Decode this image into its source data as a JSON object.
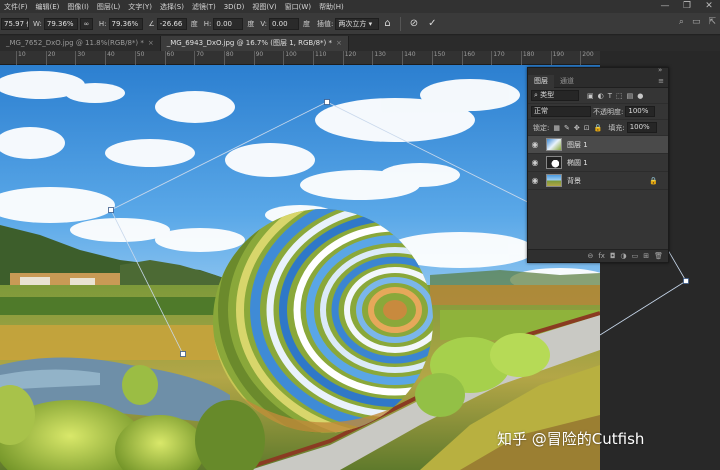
{
  "menu": [
    "文件(F)",
    "编辑(E)",
    "图像(I)",
    "图层(L)",
    "文字(Y)",
    "选择(S)",
    "滤镜(T)",
    "3D(D)",
    "视图(V)",
    "窗口(W)",
    "帮助(H)"
  ],
  "window_controls": [
    "—",
    "❐",
    "✕"
  ],
  "options": {
    "x_value": "75.97 像",
    "w_label": "W:",
    "w_value": "79.36%",
    "link_icon": "∞",
    "h_label": "H:",
    "h_value": "79.36%",
    "angle_icon": "∠",
    "angle_value": "-26.66",
    "angle_unit": "度",
    "hskew_label": "H:",
    "hskew_value": "0.00",
    "hskew_unit": "度",
    "vskew_label": "V:",
    "vskew_value": "0.00",
    "vskew_unit": "度",
    "interp_label": "插值:",
    "interp_value": "两次立方 ▾",
    "cancel_icon": "⊘",
    "commit_icon": "✓"
  },
  "tabs": [
    {
      "label": "_MG_7652_DxO.jpg @ 11.8%(RGB/8*) *",
      "close": "×"
    },
    {
      "label": "_MG_6943_DxO.jpg @ 16.7% (图层 1, RGB/8*) *",
      "close": "×"
    }
  ],
  "ruler_ticks": [
    "10",
    "20",
    "30",
    "40",
    "50",
    "60",
    "70",
    "80",
    "90",
    "100",
    "110",
    "120",
    "130",
    "140",
    "150",
    "160",
    "170",
    "180",
    "190",
    "200"
  ],
  "panel": {
    "tabs": [
      "图层",
      "通道"
    ],
    "search_placeholder": "类型",
    "blend_mode": "正常",
    "opacity_label": "不透明度:",
    "opacity_value": "100%",
    "lock_label": "锁定:",
    "fill_label": "填充:",
    "fill_value": "100%",
    "layers": [
      {
        "name": "图层 1",
        "selected": true
      },
      {
        "name": "椭圆 1",
        "selected": false
      },
      {
        "name": "背景",
        "selected": false
      }
    ],
    "bottom_icons": [
      "⊖",
      "fx",
      "◘",
      "◑",
      "▭",
      "⊞",
      "🗑"
    ]
  },
  "watermark": "知乎 @冒险的Cutfish",
  "colors": {
    "ps_dark": "#282828",
    "panel": "#353535",
    "accent": "#4a90d9"
  }
}
